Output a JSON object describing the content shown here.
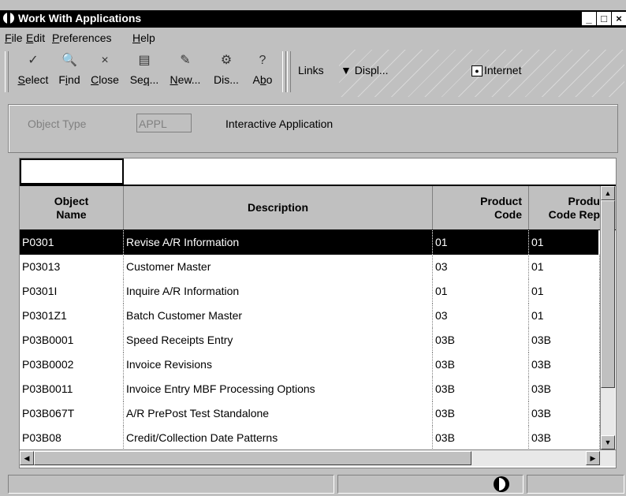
{
  "window": {
    "title": "Work With Applications",
    "buttons": {
      "minimize": "_",
      "maximize": "□",
      "close": "×"
    }
  },
  "menu": {
    "items": [
      {
        "accel": "F",
        "rest": "ile"
      },
      {
        "accel": "E",
        "rest": "dit"
      },
      {
        "accel": "P",
        "rest": "references"
      },
      {
        "accel": "H",
        "rest": "elp"
      }
    ]
  },
  "toolbar": {
    "buttons": [
      {
        "icon": "✓",
        "pre": "",
        "accel": "S",
        "post": "elect"
      },
      {
        "icon": "🔍",
        "pre": "F",
        "accel": "i",
        "post": "nd"
      },
      {
        "icon": "×",
        "pre": "",
        "accel": "C",
        "post": "lose"
      },
      {
        "icon": "▤",
        "pre": "Se",
        "accel": "q",
        "post": "..."
      },
      {
        "icon": "✎",
        "pre": "",
        "accel": "N",
        "post": "ew..."
      },
      {
        "icon": "⚙",
        "pre": "Dis...",
        "accel": "",
        "post": ""
      },
      {
        "icon": "?",
        "pre": "A",
        "accel": "b",
        "post": "o"
      }
    ],
    "links_label": "Links",
    "display_label": "Displ...",
    "internet_label": "Internet"
  },
  "filter": {
    "label": "Object Type",
    "value": "APPL",
    "description": "Interactive Application"
  },
  "grid": {
    "columns": [
      {
        "line1": "Object",
        "line2": "Name"
      },
      {
        "line1": "Description",
        "line2": ""
      },
      {
        "line1": "Product",
        "line2": "Code"
      },
      {
        "line1": "Produ",
        "line2": "Code Rep"
      }
    ],
    "rows": [
      {
        "name": "P0301",
        "desc": "Revise A/R Information",
        "prod": "01",
        "rep": "01",
        "selected": true
      },
      {
        "name": "P03013",
        "desc": "Customer Master",
        "prod": "03",
        "rep": "01"
      },
      {
        "name": "P0301I",
        "desc": "Inquire A/R Information",
        "prod": "01",
        "rep": "01"
      },
      {
        "name": "P0301Z1",
        "desc": "Batch Customer Master",
        "prod": "03",
        "rep": "01"
      },
      {
        "name": "P03B0001",
        "desc": "Speed Receipts Entry",
        "prod": "03B",
        "rep": "03B"
      },
      {
        "name": "P03B0002",
        "desc": "Invoice Revisions",
        "prod": "03B",
        "rep": "03B"
      },
      {
        "name": "P03B0011",
        "desc": "Invoice Entry MBF Processing Options",
        "prod": "03B",
        "rep": "03B"
      },
      {
        "name": "P03B067T",
        "desc": "A/R PrePost Test Standalone",
        "prod": "03B",
        "rep": "03B"
      },
      {
        "name": "P03B08",
        "desc": "Credit/Collection Date Patterns",
        "prod": "03B",
        "rep": "03B"
      }
    ]
  },
  "colors": {
    "selection": "#000000",
    "chrome": "#c0c0c0"
  }
}
